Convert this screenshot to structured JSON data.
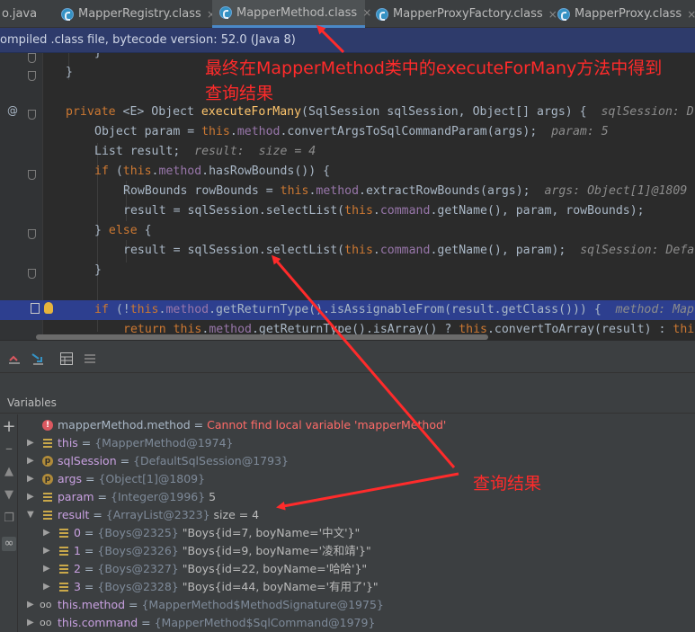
{
  "tabs": [
    {
      "label": "o.java",
      "icon": "java-file-icon",
      "close": ""
    },
    {
      "label": "MapperRegistry.class",
      "icon": "class-file-icon",
      "close": "×"
    },
    {
      "label": "MapperMethod.class",
      "icon": "class-file-icon",
      "close": "×",
      "active": true
    },
    {
      "label": "MapperProxyFactory.class",
      "icon": "class-file-icon",
      "close": "×"
    },
    {
      "label": "MapperProxy.class",
      "icon": "class-file-icon",
      "close": "×"
    }
  ],
  "infobar": {
    "text": "ompiled .class file, bytecode version: 52.0 (Java 8)"
  },
  "annotation": {
    "line1": "最终在MapperMethod类中的executeForMany方法中得到",
    "line2": "查询结果",
    "result_label": "查询结果"
  },
  "code": {
    "l1": "}",
    "l2": "}",
    "l3_kw": "private",
    "l3_a": " <E> Object ",
    "l3_fn": "executeForMany",
    "l3_b": "(SqlSession sqlSession, Object[] args) {",
    "l3_hint": "sqlSession: D",
    "l4_a": "Object param = ",
    "l4_this": "this",
    "l4_b": ".",
    "l4_fld": "method",
    "l4_c": ".convertArgsToSqlCommandParam(args);",
    "l4_hint": "param: 5",
    "l5_a": "List result;",
    "l5_hint": "result:  size = 4",
    "l6_kw": "if",
    "l6_a": " (",
    "l6_this": "this",
    "l6_b": ".",
    "l6_fld": "method",
    "l6_c": ".hasRowBounds()) {",
    "l7_a": "RowBounds rowBounds = ",
    "l7_this": "this",
    "l7_b": ".",
    "l7_fld": "method",
    "l7_c": ".extractRowBounds(args);",
    "l7_hint": "args: Object[1]@1809",
    "l8_a": "result = sqlSession.selectList(",
    "l8_this": "this",
    "l8_b": ".",
    "l8_fld": "command",
    "l8_c": ".getName(), param, rowBounds);",
    "l9_a": "} ",
    "l9_kw": "else",
    "l9_b": " {",
    "l10_a": "result = sqlSession.selectList(",
    "l10_this": "this",
    "l10_b": ".",
    "l10_fld": "command",
    "l10_c": ".getName(), param);",
    "l10_hint": "sqlSession: Defa",
    "l11": "}",
    "l12_kw": "if",
    "l12_a": " (!",
    "l12_this": "this",
    "l12_b": ".",
    "l12_fld": "method",
    "l12_c": ".getReturnType().isAssignableFrom(result.getClass())) {",
    "l12_hint": "method: Map",
    "l13_kw": "return",
    "l13_a": " ",
    "l13_this": "this",
    "l13_b": ".",
    "l13_fld": "method",
    "l13_c": ".getReturnType().isArray() ? ",
    "l13_this2": "this",
    "l13_d": ".convertToArray(result) : ",
    "l13_this3": "thi",
    "at_mark": "@"
  },
  "debug": {
    "variables_label": "Variables",
    "rows": [
      {
        "name": "mapperMethod.method",
        "eq": " = ",
        "value": "Cannot find local variable 'mapperMethod'",
        "icon": "error-icon"
      },
      {
        "name": "this",
        "eq": " = ",
        "type": "{MapperMethod@1974}",
        "icon": "field-icon"
      },
      {
        "name": "sqlSession",
        "eq": " = ",
        "type": "{DefaultSqlSession@1793}",
        "icon": "param-icon"
      },
      {
        "name": "args",
        "eq": " = ",
        "type": "{Object[1]@1809}",
        "icon": "param-icon"
      },
      {
        "name": "param",
        "eq": " = ",
        "type": "{Integer@1996}",
        "extra": " 5",
        "icon": "field-icon"
      },
      {
        "name": "result",
        "eq": " = ",
        "type": "{ArrayList@2323}",
        "extra": "  size = 4",
        "icon": "field-icon"
      },
      {
        "name": "0",
        "eq": " = ",
        "type": "{Boys@2325}",
        "extra": " \"Boys{id=7, boyName='中文'}\"",
        "icon": "field-icon"
      },
      {
        "name": "1",
        "eq": " = ",
        "type": "{Boys@2326}",
        "extra": " \"Boys{id=9, boyName='凌和靖'}\"",
        "icon": "field-icon"
      },
      {
        "name": "2",
        "eq": " = ",
        "type": "{Boys@2327}",
        "extra": " \"Boys{id=22, boyName='哈哈'}\"",
        "icon": "field-icon"
      },
      {
        "name": "3",
        "eq": " = ",
        "type": "{Boys@2328}",
        "extra": " \"Boys{id=44, boyName='有用了'}\"",
        "icon": "field-icon"
      },
      {
        "name": "this.method",
        "eq": " = ",
        "type": "{MapperMethod$MethodSignature@1975}",
        "icon": "watch-icon"
      },
      {
        "name": "this.command",
        "eq": " = ",
        "type": "{MapperMethod$SqlCommand@1979}",
        "icon": "watch-icon"
      }
    ]
  },
  "colors": {
    "annotation": "#ff2b2b",
    "highlight": "#2d3f8f",
    "accent": "#4a88c7"
  }
}
